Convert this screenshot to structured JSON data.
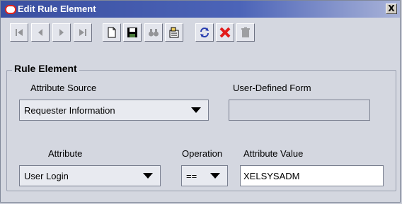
{
  "window": {
    "title": "Edit Rule Element",
    "close_label": "X"
  },
  "toolbar": {
    "buttons": [
      {
        "name": "first-record-button"
      },
      {
        "name": "previous-record-button"
      },
      {
        "name": "next-record-button"
      },
      {
        "name": "last-record-button"
      },
      {
        "name": "new-button"
      },
      {
        "name": "save-button"
      },
      {
        "name": "find-button"
      },
      {
        "name": "query-button"
      },
      {
        "name": "refresh-button"
      },
      {
        "name": "delete-button"
      },
      {
        "name": "trash-button"
      }
    ]
  },
  "group": {
    "title": "Rule Element"
  },
  "form": {
    "attribute_source_label": "Attribute Source",
    "attribute_source_value": "Requester Information",
    "user_defined_form_label": "User-Defined Form",
    "user_defined_form_value": "",
    "attribute_label": "Attribute",
    "attribute_value_selected": "User Login",
    "operation_label": "Operation",
    "operation_value": "==",
    "attribute_value_label": "Attribute Value",
    "attribute_value_input": "XELSYSADM"
  },
  "colors": {
    "delete": "#e21b1b",
    "refresh": "#2a3fb0",
    "title_bar": "#3a4fa0"
  }
}
